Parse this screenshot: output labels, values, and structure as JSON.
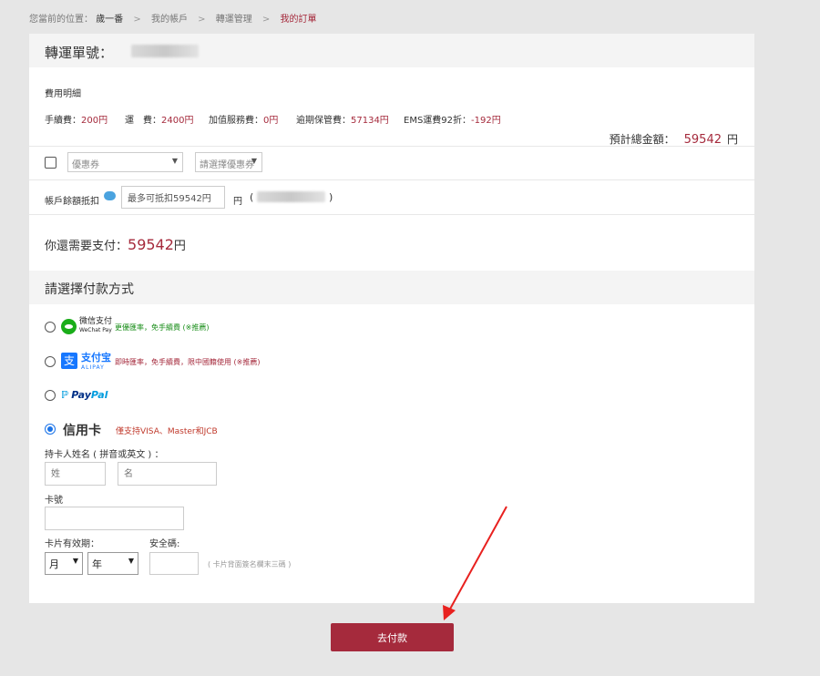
{
  "breadcrumb": {
    "prefix": "您當前的位置：",
    "items": [
      "歲一番",
      "我的帳戶",
      "轉運管理",
      "我的訂單"
    ],
    "sep": ">"
  },
  "order": {
    "label": "轉運單號："
  },
  "fees": {
    "title": "費用明細",
    "items": [
      {
        "label": "手續費：",
        "value": "200円"
      },
      {
        "label": "運　費：",
        "value": "2400円"
      },
      {
        "label": "加值服務費：",
        "value": "0円"
      },
      {
        "label": "逾期保管費：",
        "value": "57134円"
      },
      {
        "label": "EMS運費92折：",
        "value": "-192円"
      }
    ],
    "total_label": "預計總金額：",
    "total_value": "59542",
    "total_unit": "円"
  },
  "coupon": {
    "select1": "優惠券",
    "select2": "請選擇優惠券"
  },
  "account": {
    "label": "帳戶餘額抵扣",
    "input_value": "最多可抵扣59542円",
    "unit": "円",
    "paren_open": "(",
    "paren_close": ")"
  },
  "need_pay": {
    "label": "你還需要支付：",
    "value": "59542",
    "unit": "円"
  },
  "payment": {
    "title": "請選擇付款方式",
    "wechat": {
      "cn": "微信支付",
      "en": "WeChat Pay",
      "note": "更優匯率，免手續費 (※推薦)"
    },
    "alipay": {
      "icon": "支",
      "cn": "支付宝",
      "en": "ALIPAY",
      "note": "即時匯率，免手續費，限中國籍使用 (※推薦)"
    },
    "paypal": {
      "p1": "Pay",
      "p2": "Pal"
    },
    "credit": {
      "title": "信用卡",
      "note": "僅支持VISA、Master和JCB",
      "name_label": "持卡人姓名 ( 拼音或英文 ) ：",
      "last_name_placeholder": "姓",
      "first_name_placeholder": "名",
      "card_label": "卡號",
      "expiry_label": "卡片有效期：",
      "month": "月",
      "year": "年",
      "cvv_label": "安全碼:",
      "cvv_hint": "( 卡片背面簽名欄末三碼 )"
    }
  },
  "submit_label": "去付款",
  "colors": {
    "accent": "#a52a3c",
    "wechat": "#1aad19",
    "alipay": "#1677ff",
    "radio": "#1a73e8"
  }
}
